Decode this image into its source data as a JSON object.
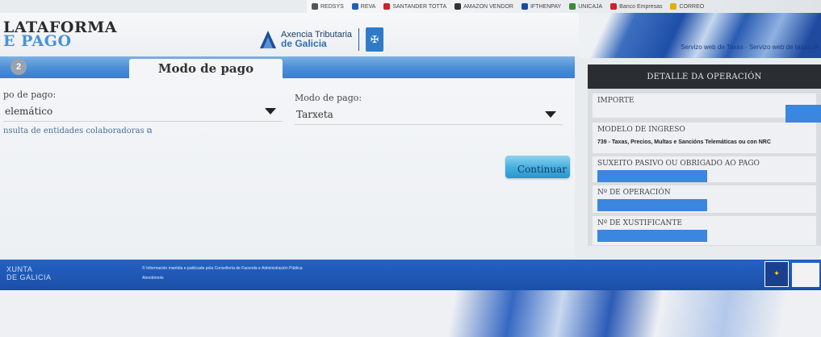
{
  "bookmarks": [
    "REDSYS",
    "REVA",
    "SANTANDER TOTTA",
    "AMAZON VENDOR",
    "IFTHENPAY",
    "UNICAJA",
    "Banco Empresas",
    "CORREO"
  ],
  "header": {
    "brand_line1": "LATAFORMA",
    "brand_line2": "E PAGO",
    "atg_line1": "Axencia Tributaria",
    "atg_line2": "de Galicia",
    "tagline": "Servizo web de Taxas · Servizo web de taxas de"
  },
  "main": {
    "step_number": "2",
    "title": "Modo de pago",
    "tipo_label": "po de pago:",
    "tipo_value": "elemático",
    "modo_label": "Modo de pago:",
    "modo_value": "Tarxeta",
    "link_text": "nsulta de entidades colaboradoras",
    "continue_label": "Continuar"
  },
  "detail": {
    "heading": "DETALLE DA OPERACIÓN",
    "importe_label": "IMPORTE",
    "modelo_label": "MODELO DE INGRESO",
    "modelo_value": "739 - Taxas, Precios, Multas e Sancións Telemáticas ou con NRC",
    "suxeito_label": "SUXEITO PASIVO OU OBRIGADO AO PAGO",
    "operacion_label": "Nº DE OPERACIÓN",
    "xustificante_label": "Nº DE XUSTIFICANTE"
  },
  "footer": {
    "xunta_line1": "XUNTA",
    "xunta_line2": "DE GALICIA",
    "info_text": "© Información mantida e publicada pola Consellería de Facenda e Administración Pública",
    "atendemolo": "Atendémolo"
  },
  "colors": {
    "primary_blue": "#3b7dcc",
    "footer_blue": "#1b4fa6",
    "button_blue": "#41aee0",
    "detail_head": "#2a2d31"
  }
}
